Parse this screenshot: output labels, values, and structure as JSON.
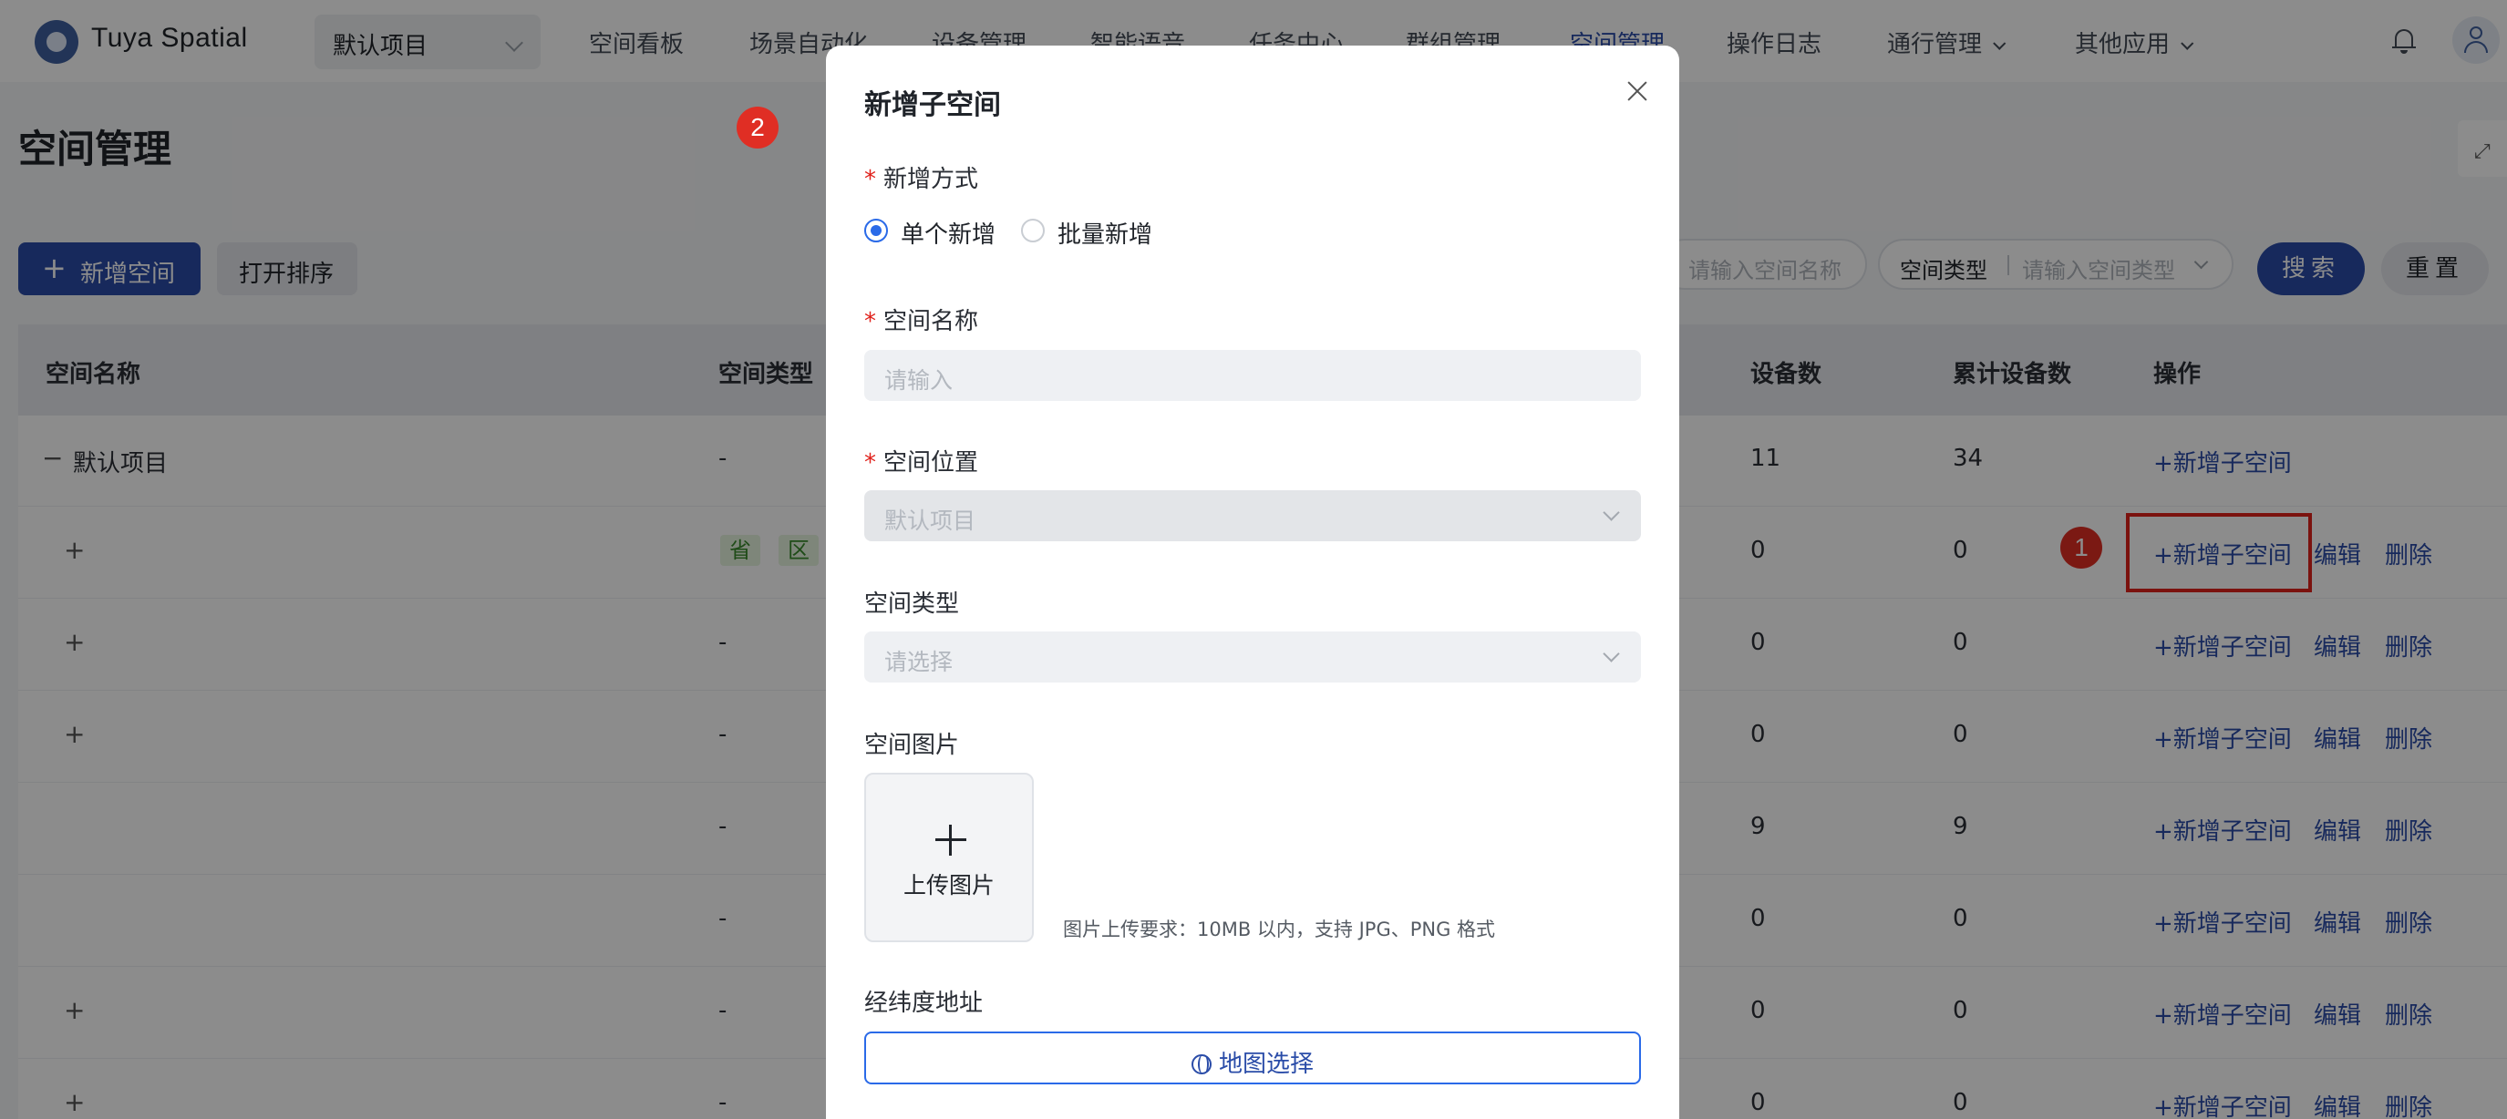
{
  "app": {
    "brand": "Tuya Spatial",
    "project": "默认项目"
  },
  "nav": [
    {
      "label": "空间看板",
      "active": false,
      "dropdown": false
    },
    {
      "label": "场景自动化",
      "active": false,
      "dropdown": false
    },
    {
      "label": "设备管理",
      "active": false,
      "dropdown": false
    },
    {
      "label": "智能语音",
      "active": false,
      "dropdown": false
    },
    {
      "label": "任务中心",
      "active": false,
      "dropdown": false
    },
    {
      "label": "群组管理",
      "active": false,
      "dropdown": false
    },
    {
      "label": "空间管理",
      "active": true,
      "dropdown": false
    },
    {
      "label": "操作日志",
      "active": false,
      "dropdown": false
    },
    {
      "label": "通行管理",
      "active": false,
      "dropdown": true
    },
    {
      "label": "其他应用",
      "active": false,
      "dropdown": true
    }
  ],
  "page": {
    "title": "空间管理",
    "add_button": "新增空间",
    "sort_button": "打开排序",
    "filter_name_placeholder": "请输入空间名称",
    "filter_type_label": "空间类型",
    "filter_type_placeholder": "请输入空间类型",
    "search_button": "搜索",
    "reset_button": "重置"
  },
  "table": {
    "columns": {
      "name": "空间名称",
      "type": "空间类型",
      "devices": "设备数",
      "total_devices": "累计设备数",
      "actions": "操作"
    },
    "action_add": "+新增子空间",
    "action_edit": "编辑",
    "action_delete": "删除",
    "rows": [
      {
        "expander": "−",
        "name": "默认项目",
        "type": "-",
        "tags": [],
        "devices": "11",
        "total": "34",
        "edit": false
      },
      {
        "expander": "+",
        "name": "",
        "type": "",
        "tags": [
          "省",
          "区"
        ],
        "devices": "0",
        "total": "0",
        "edit": true
      },
      {
        "expander": "+",
        "name": "",
        "type": "-",
        "tags": [],
        "devices": "0",
        "total": "0",
        "edit": true
      },
      {
        "expander": "+",
        "name": "",
        "type": "-",
        "tags": [],
        "devices": "0",
        "total": "0",
        "edit": true
      },
      {
        "expander": "",
        "name": "",
        "type": "-",
        "tags": [],
        "devices": "9",
        "total": "9",
        "edit": true
      },
      {
        "expander": "",
        "name": "",
        "type": "-",
        "tags": [],
        "devices": "0",
        "total": "0",
        "edit": true
      },
      {
        "expander": "+",
        "name": "",
        "type": "-",
        "tags": [],
        "devices": "0",
        "total": "0",
        "edit": true
      },
      {
        "expander": "+",
        "name": "",
        "type": "-",
        "tags": [],
        "devices": "0",
        "total": "0",
        "edit": true
      }
    ]
  },
  "markers": {
    "one": "1",
    "two": "2"
  },
  "modal": {
    "title": "新增子空间",
    "mode_label": "新增方式",
    "mode_single": "单个新增",
    "mode_batch": "批量新增",
    "selected_mode": "single",
    "name_label": "空间名称",
    "name_placeholder": "请输入",
    "location_label": "空间位置",
    "location_value": "默认项目",
    "type_label": "空间类型",
    "type_placeholder": "请选择",
    "image_label": "空间图片",
    "upload_label": "上传图片",
    "upload_hint": "图片上传要求：10MB 以内，支持 JPG、PNG 格式",
    "coords_label": "经纬度地址",
    "map_button": "地图选择"
  },
  "colors": {
    "primary": "#2a4ca8",
    "accent": "#2a6ae8",
    "required": "#e0211b",
    "marker": "#e02e24",
    "tag_green": "#3a8a2c"
  }
}
